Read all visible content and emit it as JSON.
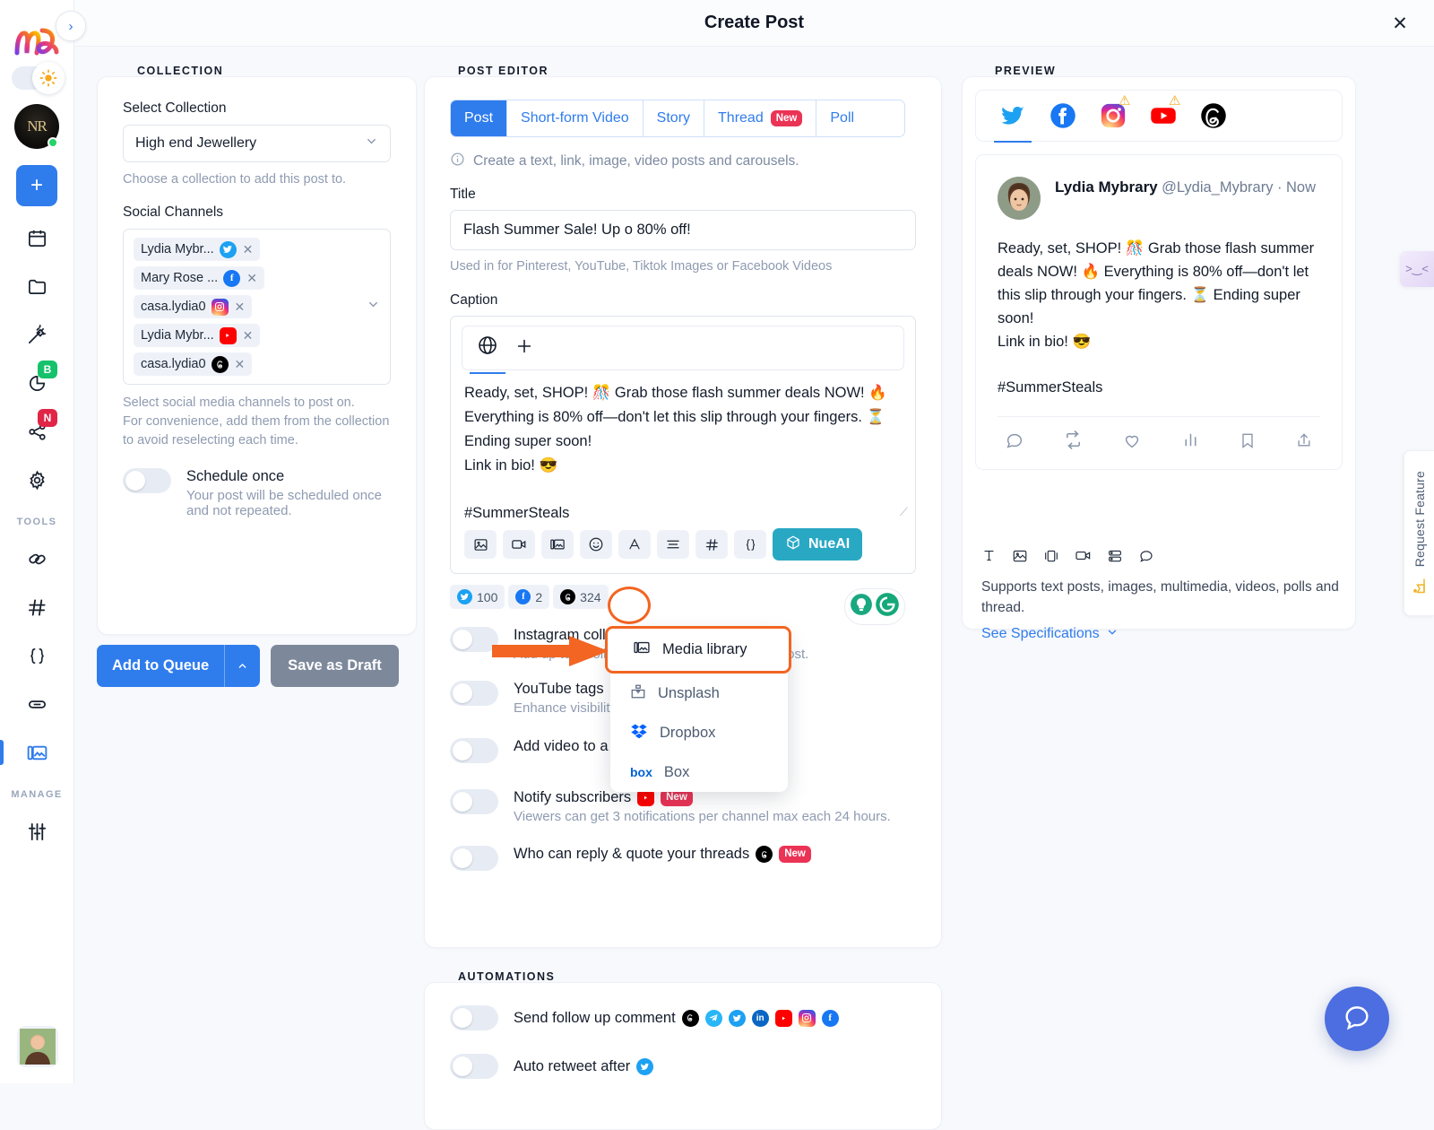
{
  "window": {
    "title": "Create Post",
    "close_icon": "close-icon"
  },
  "rail": {
    "expand_icon": "chevron-right-icon",
    "logo": "nl-logo",
    "theme_icon": "sun-icon",
    "brand_initials": "NR",
    "add_label": "+",
    "items": [
      {
        "name": "calendar",
        "badge": null
      },
      {
        "name": "folder",
        "badge": null
      },
      {
        "name": "magic-wand",
        "badge": null
      },
      {
        "name": "analytics",
        "badge": "B",
        "badge_color": "#15c26b"
      },
      {
        "name": "share",
        "badge": "N",
        "badge_color": "#e02547"
      },
      {
        "name": "settings",
        "badge": null
      }
    ],
    "tools_label": "TOOLS",
    "tools": [
      "link-chain",
      "hashtag",
      "curly-braces",
      "shortlink",
      "media-library"
    ],
    "manage_label": "MANAGE",
    "manage": [
      "sliders"
    ]
  },
  "collection": {
    "section_label": "COLLECTION",
    "select_label": "Select Collection",
    "selected_collection": "High end Jewellery",
    "select_hint": "Choose a collection to add this post to.",
    "channels_label": "Social Channels",
    "channels": [
      {
        "name": "Lydia Mybr...",
        "network": "twitter"
      },
      {
        "name": "Mary Rose ...",
        "network": "facebook"
      },
      {
        "name": "casa.lydia0",
        "network": "instagram"
      },
      {
        "name": "Lydia Mybr...",
        "network": "youtube"
      },
      {
        "name": "casa.lydia0",
        "network": "threads"
      }
    ],
    "channels_hint_1": "Select social media channels to post on.",
    "channels_hint_2": "For convenience, add them from the collection to avoid reselecting each time.",
    "schedule_toggle": {
      "label": "Schedule once",
      "sub": "Your post will be scheduled once and not repeated.",
      "on": false
    },
    "add_to_queue": "Add to Queue",
    "add_to_queue_caret": "chevron-up-icon",
    "save_as_draft": "Save as Draft"
  },
  "editor": {
    "section_label": "POST EDITOR",
    "tabs": [
      {
        "label": "Post",
        "active": true,
        "badge": null
      },
      {
        "label": "Short-form Video",
        "active": false,
        "badge": null
      },
      {
        "label": "Story",
        "active": false,
        "badge": null
      },
      {
        "label": "Thread",
        "active": false,
        "badge": "New"
      },
      {
        "label": "Poll",
        "active": false,
        "badge": null
      }
    ],
    "info_text": "Create a text, link, image, video posts and carousels.",
    "title_label": "Title",
    "title_value": "Flash Summer Sale! Up o 80% off!",
    "title_hint": "Used in for Pinterest, YouTube, Tiktok Images or Facebook Videos",
    "caption_label": "Caption",
    "caption_tabs": [
      "globe-icon",
      "plus-icon"
    ],
    "caption_lines": [
      "Ready, set, SHOP! 🎊 Grab those flash summer deals NOW! 🔥 Everything is 80% off—don't let this slip through your fingers. ⏳ Ending super soon!",
      "Link in bio! 😎",
      "",
      "#SummerSteals"
    ],
    "toolbar": [
      "image-icon",
      "video-icon",
      "media-library-icon",
      "emoji-icon",
      "font-icon",
      "align-icon",
      "hashtag-icon",
      "variable-icon"
    ],
    "nueai_label": "NueAI",
    "assistants": [
      "ai-bulb-icon",
      "grammarly-icon"
    ],
    "counters": [
      {
        "network": "twitter",
        "value": "100"
      },
      {
        "network": "facebook",
        "value": "2"
      },
      {
        "network": "threads",
        "value": "324"
      }
    ],
    "toggles": [
      {
        "label": "Instagram collaborators",
        "badge": "New",
        "networks": [
          "instagram"
        ],
        "sub": "Add up to 3 collaborators for your Instagram post.",
        "on": false
      },
      {
        "label": "YouTube tags",
        "badge": null,
        "networks": [
          "youtube"
        ],
        "sub": "Enhance visibility with relevant tags.",
        "on": false
      },
      {
        "label": "Add video to a YouTube playlist",
        "badge": null,
        "networks": [
          "youtube"
        ],
        "sub": "",
        "on": false
      },
      {
        "label": "Notify subscribers",
        "badge": "New",
        "networks": [
          "youtube"
        ],
        "sub": "Viewers can get 3 notifications per channel max each 24 hours.",
        "on": false
      },
      {
        "label": "Who can reply & quote your threads",
        "badge": "New",
        "networks": [
          "threads"
        ],
        "sub": "",
        "on": false
      }
    ]
  },
  "media_menu": {
    "highlighted": "Media library",
    "highlighted_icon": "media-library-icon",
    "items": [
      {
        "label": "Unsplash",
        "icon": "unsplash-icon"
      },
      {
        "label": "Dropbox",
        "icon": "dropbox-icon"
      },
      {
        "label": "Box",
        "icon": "box-icon"
      }
    ]
  },
  "preview": {
    "section_label": "PREVIEW",
    "channels": [
      {
        "network": "twitter",
        "active": true,
        "warning": false
      },
      {
        "network": "facebook",
        "active": false,
        "warning": false
      },
      {
        "network": "instagram",
        "active": false,
        "warning": true
      },
      {
        "network": "youtube",
        "active": false,
        "warning": true
      },
      {
        "network": "threads",
        "active": false,
        "warning": false
      }
    ],
    "author_name": "Lydia Mybrary",
    "author_handle": "@Lydia_Mybrary ·",
    "timestamp": "Now",
    "body_lines": [
      "Ready, set, SHOP! 🎊 Grab those flash summer deals NOW! 🔥 Everything is 80% off—don't let this slip through your fingers. ⏳ Ending super soon!",
      "Link in bio! 😎",
      "",
      "#SummerSteals"
    ],
    "actions": [
      "reply-icon",
      "retweet-icon",
      "like-icon",
      "stats-icon",
      "bookmark-icon",
      "share-icon"
    ],
    "spec_icons": [
      "text-icon",
      "image-icon",
      "carousel-icon",
      "video-icon",
      "poll-icon",
      "thread-icon"
    ],
    "spec_text": "Supports text posts, images, multimedia, videos, polls and thread.",
    "spec_link": "See Specifications",
    "spec_link_caret": "chevron-down-icon"
  },
  "automations": {
    "section_label": "AUTOMATIONS",
    "items": [
      {
        "label": "Send follow up comment",
        "networks": [
          "threads",
          "telegram",
          "twitter",
          "linkedin",
          "youtube",
          "instagram",
          "facebook"
        ],
        "on": false
      },
      {
        "label": "Auto retweet after",
        "networks": [
          "twitter"
        ],
        "on": false
      }
    ]
  },
  "floaters": {
    "request_feature": "Request Feature",
    "request_feature_icon": "feature-flag-icon",
    "collapse_icon": "collapse-icon",
    "help_icon": "chat-bubble-icon"
  },
  "colors": {
    "accent": "#2f7ced",
    "highlight": "#f26522",
    "badge_new": "#eb3355",
    "nueai": "#29a8c4"
  }
}
